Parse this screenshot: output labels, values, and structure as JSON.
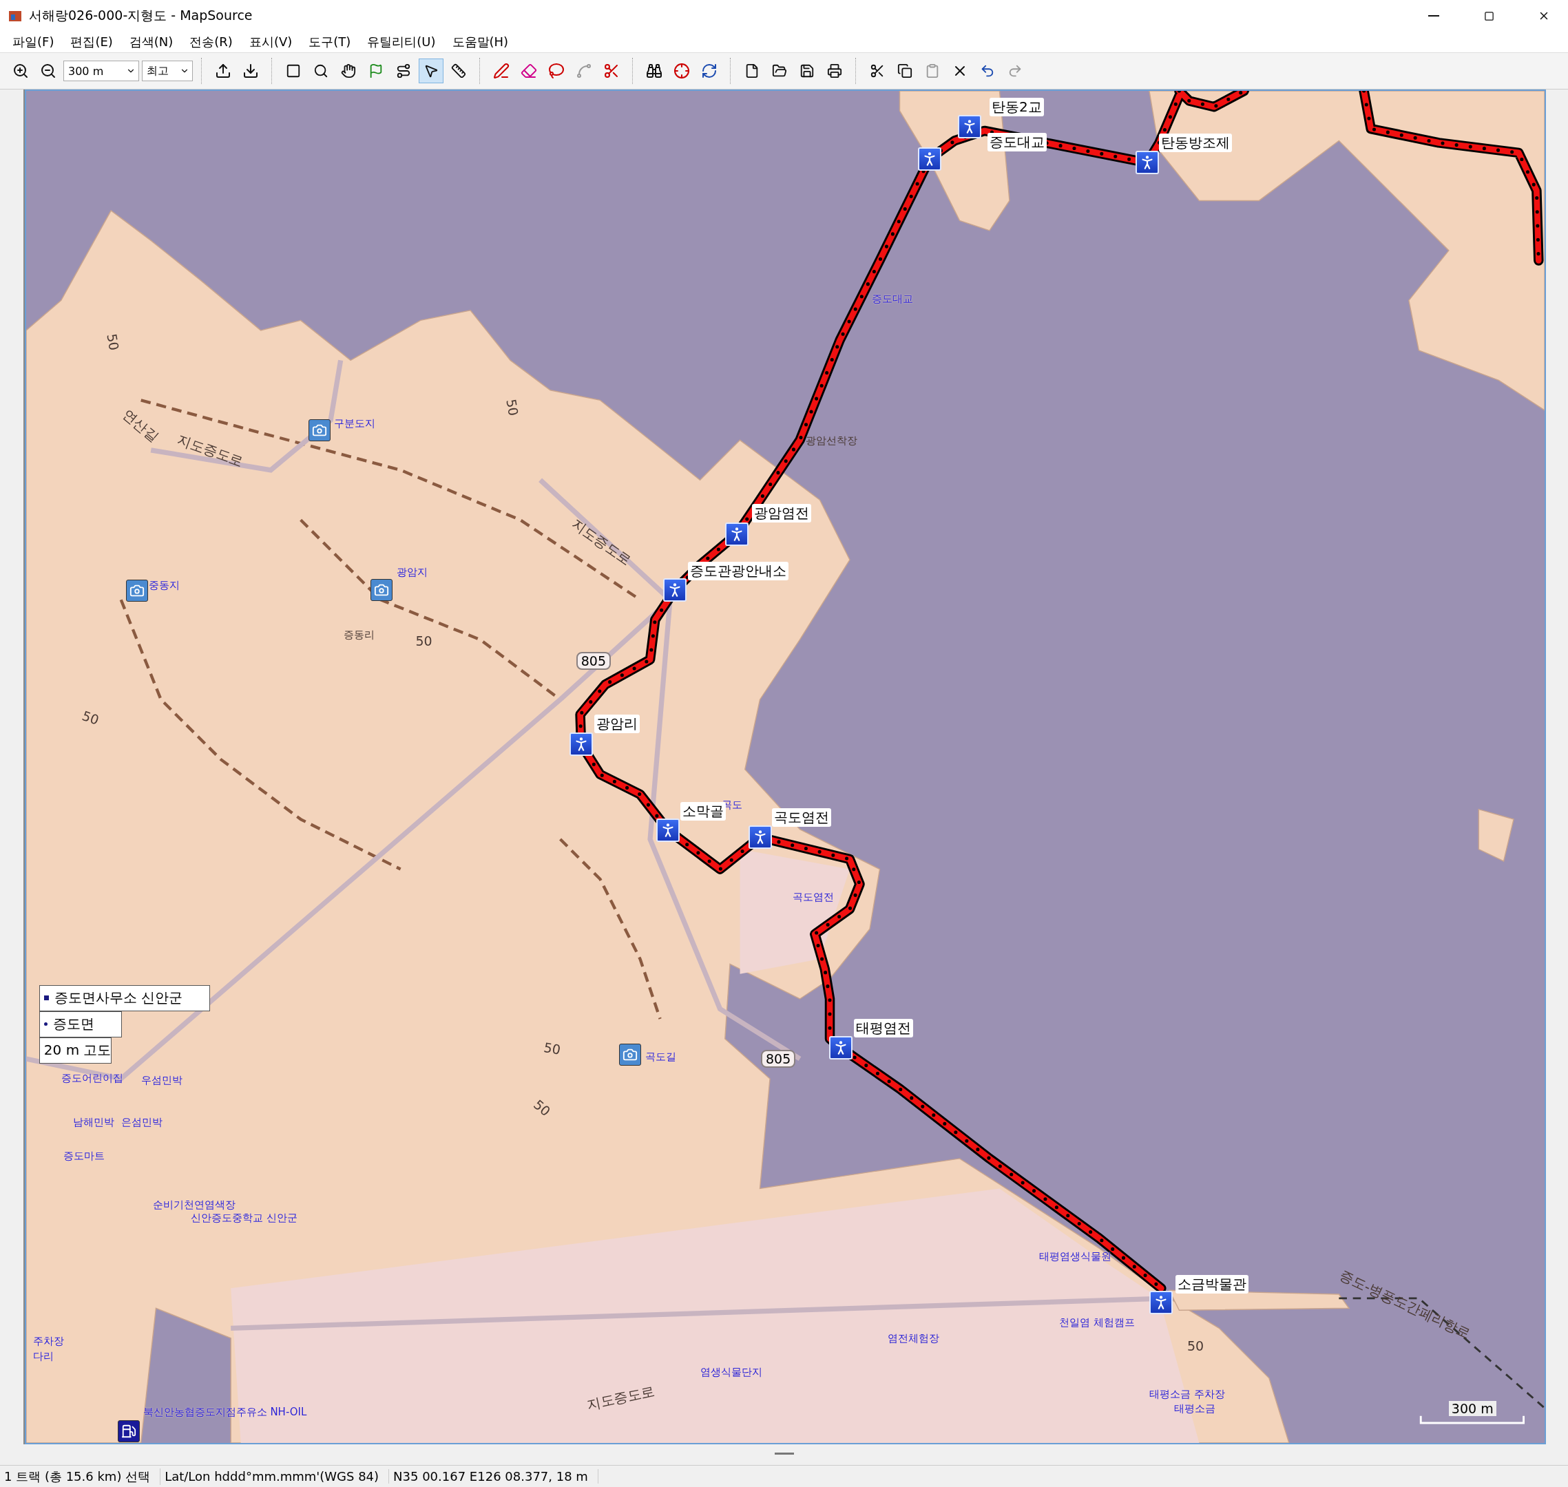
{
  "window": {
    "title": "서해랑026-000-지형도 - MapSource"
  },
  "menu": [
    "파일(F)",
    "편집(E)",
    "검색(N)",
    "전송(R)",
    "표시(V)",
    "도구(T)",
    "유틸리티(U)",
    "도움말(H)"
  ],
  "toolbar": {
    "zoom_select": "300 m",
    "detail_select": "최고",
    "tools": [
      {
        "selected": false
      },
      {
        "selected": false
      },
      {
        "selected": false
      },
      {
        "selected": false
      },
      {
        "selected": false
      },
      {
        "selected": true
      },
      {
        "selected": false
      }
    ]
  },
  "map": {
    "waypoints": [
      {
        "label": "탄동2교"
      },
      {
        "label": "증도대교"
      },
      {
        "label": "탄동방조제"
      },
      {
        "label": "광암염전"
      },
      {
        "label": "증도관광안내소"
      },
      {
        "label": "광암리"
      },
      {
        "label": "소막골"
      },
      {
        "label": "곡도염전"
      },
      {
        "label": "태평염전"
      },
      {
        "label": "소금박물관"
      }
    ],
    "route_shields": [
      "805",
      "805"
    ],
    "road_labels": [
      "지도증도로",
      "지도증도로",
      "지도증도로",
      "연산길",
      "증도-병풍도간페리항로"
    ],
    "place_labels": [
      "증동리",
      "광암선착장"
    ],
    "contour_labels": [
      "50",
      "50",
      "50",
      "50",
      "50",
      "50",
      "50"
    ],
    "poi_labels": [
      "구분도지",
      "중동지",
      "광암지",
      "증도대교",
      "곡도염전",
      "곡도",
      "곡도길",
      "증도어린이집",
      "우섬민박",
      "남해민박",
      "은섬민박",
      "증도마트",
      "순비기천연염색장",
      "신안증도중학교 신안군",
      "북신안농협증도지점주유소 NH-OIL",
      "염전체험장",
      "염생식물단지",
      "태평염생식물원",
      "천일염 체험캠프",
      "태평소금 주차장",
      "태평소금",
      "주차장",
      "다리"
    ],
    "tooltip": [
      {
        "text": "증도면사무소 신안군",
        "kind": "square"
      },
      {
        "text": "증도면",
        "kind": "dot"
      },
      {
        "text": "20 m 고도",
        "kind": "plain"
      }
    ],
    "scale": "300 m"
  },
  "status_bar": [
    "1 트랙 (총 15.6 km) 선택",
    "Lat/Lon hddd°mm.mmm'(WGS 84)",
    "N35 00.167 E126 08.377, 18 m"
  ]
}
